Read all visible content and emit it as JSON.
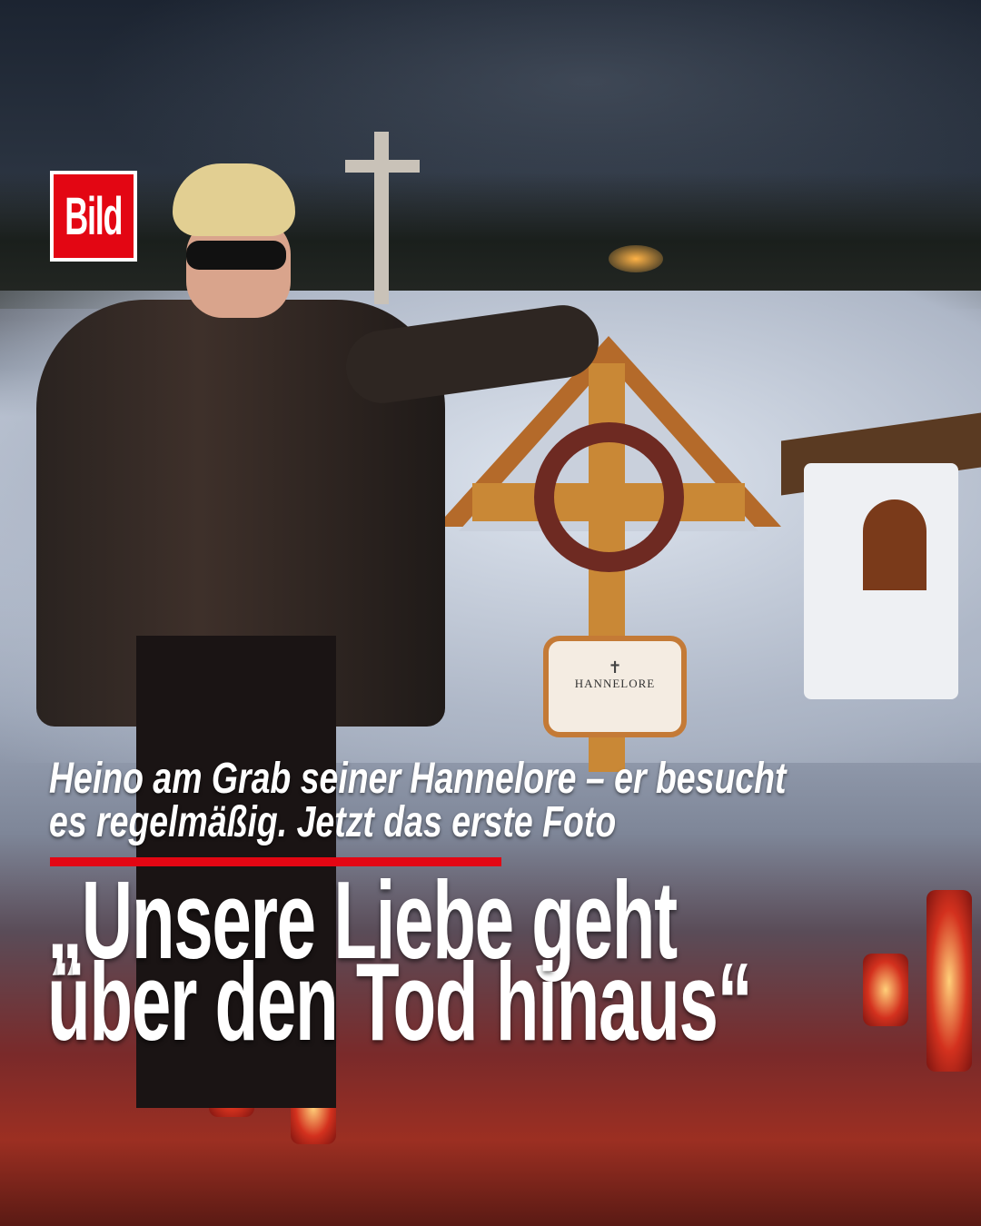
{
  "brand": {
    "logo_text": "Bild",
    "color": "#e30613"
  },
  "photo": {
    "nameplate_text": "HANNELORE",
    "nameplate_cross": "✝"
  },
  "subtitle": {
    "lines": [
      "Heino am Grab seiner Hannelore – er besucht",
      "es regelmäßig. Jetzt das erste Foto"
    ]
  },
  "headline": {
    "lines": [
      "„Unsere Liebe geht",
      "über den Tod hinaus“"
    ]
  }
}
